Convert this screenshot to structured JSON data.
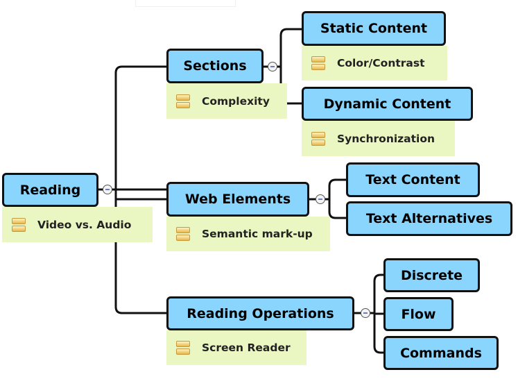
{
  "map": {
    "root": {
      "label": "Reading",
      "note": "Video vs. Audio"
    },
    "sections": {
      "label": "Sections",
      "note": "Complexity"
    },
    "static_content": {
      "label": "Static Content",
      "note": "Color/Contrast"
    },
    "dynamic_content": {
      "label": "Dynamic Content",
      "note": "Synchronization"
    },
    "web_elements": {
      "label": "Web Elements",
      "note": "Semantic mark-up"
    },
    "text_content": {
      "label": "Text Content"
    },
    "text_alternatives": {
      "label": "Text Alternatives"
    },
    "reading_operations": {
      "label": "Reading Operations",
      "note": "Screen Reader"
    },
    "discrete": {
      "label": "Discrete"
    },
    "flow": {
      "label": "Flow"
    },
    "commands": {
      "label": "Commands"
    }
  },
  "colors": {
    "topic_fill": "#8ad5fd",
    "note_fill": "#eaf7c3",
    "border": "#111111"
  },
  "icons": {
    "note": "note-icon",
    "collapse": "collapse-minus-icon"
  }
}
